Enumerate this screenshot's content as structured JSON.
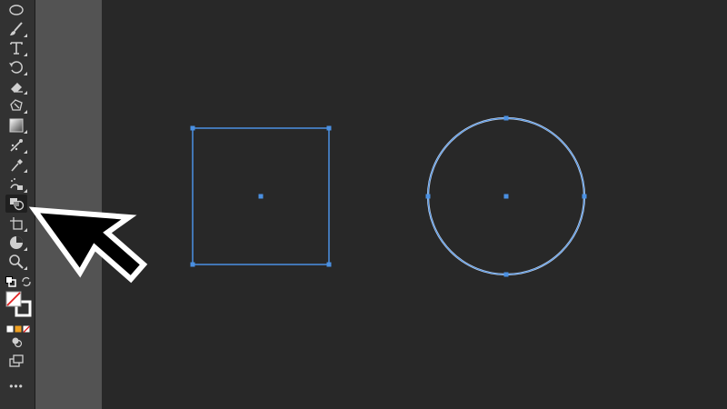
{
  "toolbar": {
    "tools": [
      {
        "name": "ellipse-tool",
        "icon": "ellipse-icon",
        "has_submenu": true
      },
      {
        "name": "paintbrush-tool",
        "icon": "paintbrush-icon",
        "has_submenu": true
      },
      {
        "name": "type-tool",
        "icon": "type-icon",
        "label": "T",
        "has_submenu": true
      },
      {
        "name": "rotate-tool",
        "icon": "rotate-icon",
        "has_submenu": true
      },
      {
        "name": "eraser-tool",
        "icon": "eraser-icon",
        "has_submenu": true
      },
      {
        "name": "free-transform-tool",
        "icon": "free-transform-icon",
        "has_submenu": true
      },
      {
        "name": "gradient-tool",
        "icon": "gradient-icon",
        "has_submenu": true
      },
      {
        "name": "blend-tool",
        "icon": "blend-icon",
        "has_submenu": true
      },
      {
        "name": "eyedropper-tool",
        "icon": "eyedropper-icon",
        "has_submenu": true
      },
      {
        "name": "symbol-sprayer-tool",
        "icon": "symbol-sprayer-icon",
        "has_submenu": true
      },
      {
        "name": "shape-builder-tool",
        "icon": "shape-builder-icon",
        "has_submenu": true,
        "active": true
      },
      {
        "name": "artboard-tool",
        "icon": "artboard-icon",
        "has_submenu": true
      },
      {
        "name": "slice-tool",
        "icon": "slice-icon",
        "has_submenu": true
      },
      {
        "name": "zoom-tool",
        "icon": "zoom-icon",
        "has_submenu": true
      }
    ],
    "more_label": "•••"
  },
  "colors": {
    "toolbar_bg": "#323232",
    "panel_bg": "#535353",
    "canvas_bg": "#282828",
    "selection_blue": "#4a90e2",
    "icon_color": "#cfcfcf"
  }
}
